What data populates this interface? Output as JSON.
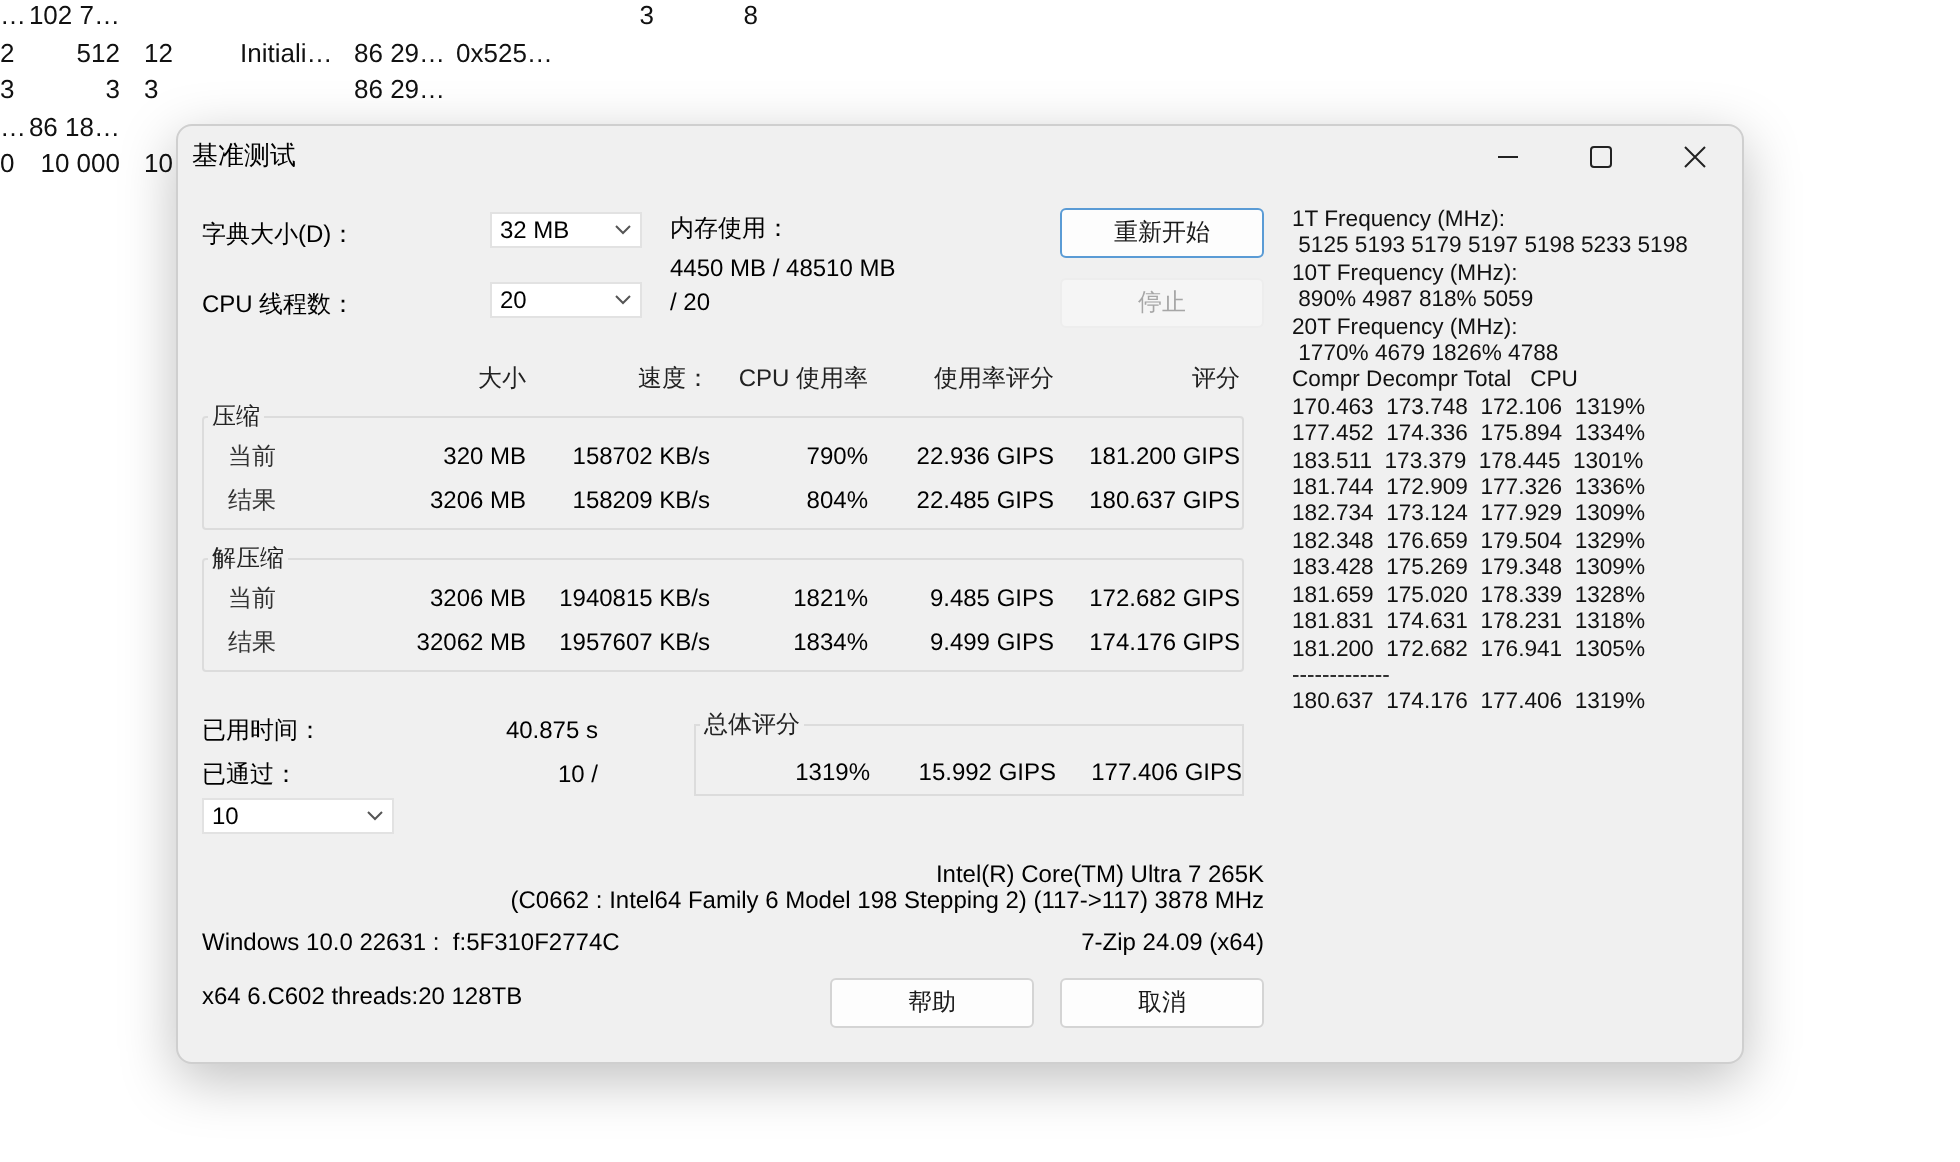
{
  "background_table": {
    "rows": [
      {
        "column_1": "…",
        "column_2": "102 7…",
        "column_7": "3",
        "column_8": "8"
      },
      {
        "column_1": "2",
        "column_2": "512",
        "column_3": "12",
        "column_4": "Initiali…",
        "column_5": "86 29…",
        "column_6": "0x525…"
      },
      {
        "column_1": "3",
        "column_2": "3",
        "column_3": "3",
        "column_5": "86 29…"
      },
      {
        "column_1": "…",
        "column_2": "86 18…"
      },
      {
        "column_1": "0",
        "column_2": "10 000",
        "column_3": "10"
      }
    ]
  },
  "dialog": {
    "title": "基准测试",
    "dictionary": {
      "label": "字典大小(D)：",
      "value": "32 MB"
    },
    "memory": {
      "label": "内存使用：",
      "value": "4450 MB / 48510 MB"
    },
    "threads": {
      "label": "CPU 线程数：",
      "value": "20",
      "max": "/ 20"
    },
    "side_buttons": [
      {
        "label": "重新开始",
        "disabled": false,
        "focused": true
      },
      {
        "label": "停止",
        "disabled": true,
        "focused": false
      }
    ],
    "columns": [
      "大小",
      "速度：",
      "CPU 使用率",
      "使用率评分",
      "评分"
    ],
    "groups": [
      {
        "title": "压缩",
        "rows": [
          {
            "label": "当前",
            "values": [
              "320 MB",
              "158702 KB/s",
              "790%",
              "22.936 GIPS",
              "181.200 GIPS"
            ]
          },
          {
            "label": "结果",
            "values": [
              "3206 MB",
              "158209 KB/s",
              "804%",
              "22.485 GIPS",
              "180.637 GIPS"
            ]
          }
        ]
      },
      {
        "title": "解压缩",
        "rows": [
          {
            "label": "当前",
            "values": [
              "3206 MB",
              "1940815 KB/s",
              "1821%",
              "9.485 GIPS",
              "172.682 GIPS"
            ]
          },
          {
            "label": "结果",
            "values": [
              "32062 MB",
              "1957607 KB/s",
              "1834%",
              "9.499 GIPS",
              "174.176 GIPS"
            ]
          }
        ]
      }
    ],
    "elapsed": {
      "label": "已用时间：",
      "value": "40.875 s"
    },
    "passes": {
      "label": "已通过：",
      "value": "10 /",
      "select": "10"
    },
    "overall": {
      "title": "总体评分",
      "values": [
        "1319%",
        "15.992 GIPS",
        "177.406 GIPS"
      ]
    },
    "cpu_info": [
      "Intel(R) Core(TM) Ultra 7 265K",
      "(C0662 : Intel64 Family 6 Model 198 Stepping 2) (117->117) 3878 MHz"
    ],
    "os": "Windows 10.0 22631 :  f:5F310F2774C",
    "version": "7-Zip 24.09 (x64)",
    "arch": "x64 6.C602 threads:20 128TB",
    "bottom_buttons": [
      "帮助",
      "取消"
    ],
    "log_lines": [
      "1T Frequency (MHz):",
      " 5125 5193 5179 5197 5198 5233 5198",
      "10T Frequency (MHz):",
      " 890% 4987 818% 5059",
      "20T Frequency (MHz):",
      " 1770% 4679 1826% 4788",
      "Compr Decompr Total   CPU",
      "170.463  173.748  172.106  1319%",
      "177.452  174.336  175.894  1334%",
      "183.511  173.379  178.445  1301%",
      "181.744  172.909  177.326  1336%",
      "182.734  173.124  177.929  1309%",
      "182.348  176.659  179.504  1329%",
      "183.428  175.269  179.348  1309%",
      "181.659  175.020  178.339  1328%",
      "181.831  174.631  178.231  1318%",
      "181.200  172.682  176.941  1305%",
      "-------------",
      "180.637  174.176  177.406  1319%"
    ]
  }
}
